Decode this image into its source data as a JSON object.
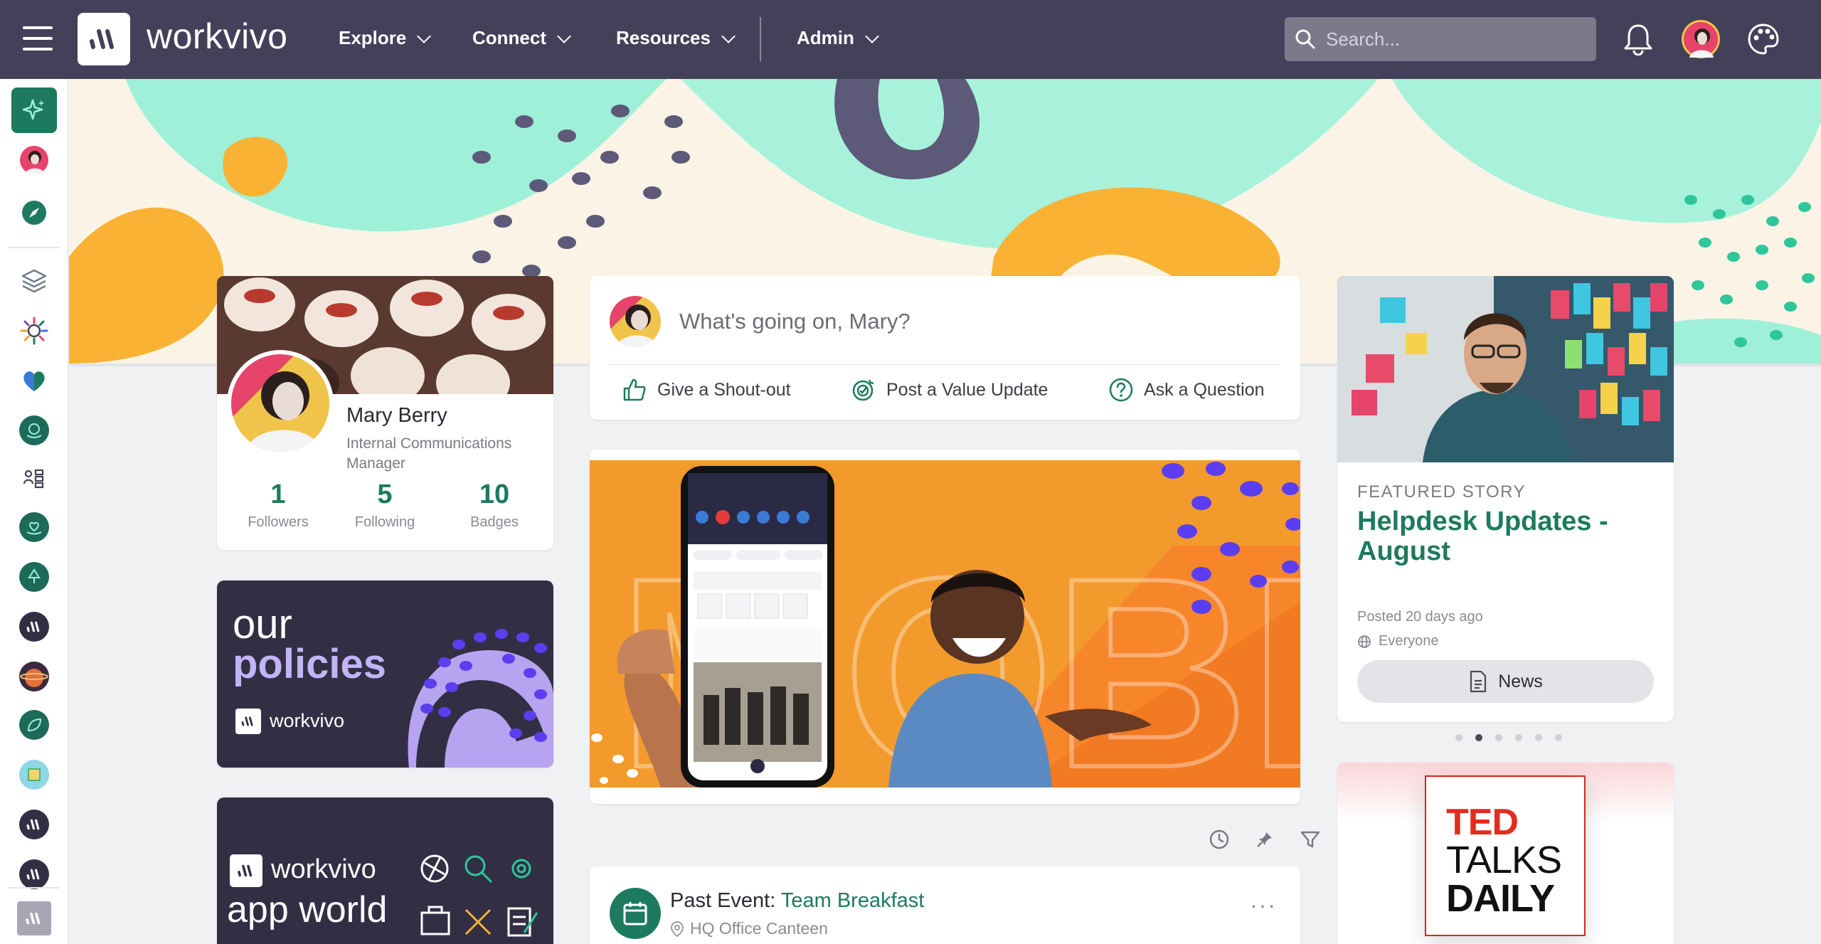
{
  "app": {
    "brand": "workvivo"
  },
  "nav": {
    "items": [
      {
        "label": "Explore"
      },
      {
        "label": "Connect"
      },
      {
        "label": "Resources"
      },
      {
        "label": "Admin"
      }
    ]
  },
  "search": {
    "placeholder": "Search..."
  },
  "profile": {
    "name": "Mary Berry",
    "role": "Internal Communications Manager",
    "stats": [
      {
        "value": "1",
        "label": "Followers"
      },
      {
        "value": "5",
        "label": "Following"
      },
      {
        "value": "10",
        "label": "Badges"
      }
    ]
  },
  "policies": {
    "line1": "our",
    "line2": "policies",
    "brand": "workvivo"
  },
  "appworld": {
    "brand": "workvivo",
    "line": "app world"
  },
  "composer": {
    "placeholder": "What's going on, Mary?",
    "actions": [
      {
        "label": "Give a Shout-out"
      },
      {
        "label": "Post a Value Update"
      },
      {
        "label": "Ask a Question"
      }
    ]
  },
  "promo": {
    "bg_word": "MOBILE"
  },
  "event": {
    "prefix": "Past Event: ",
    "name": "Team Breakfast",
    "location": "HQ Office Canteen"
  },
  "story": {
    "kicker": "FEATURED STORY",
    "title": "Helpdesk Updates - August",
    "posted": "Posted 20 days ago",
    "audience": "Everyone",
    "button": "News",
    "carousel_count": 6,
    "carousel_active": 1
  },
  "ted": {
    "line1": "TED",
    "line2": "TALKS",
    "line3": "DAILY"
  },
  "colors": {
    "topbar": "#434159",
    "accent": "#1d7a5f",
    "banner_orange": "#f9b233",
    "banner_mint": "#9ff0d8",
    "banner_purple": "#5c5a78"
  }
}
